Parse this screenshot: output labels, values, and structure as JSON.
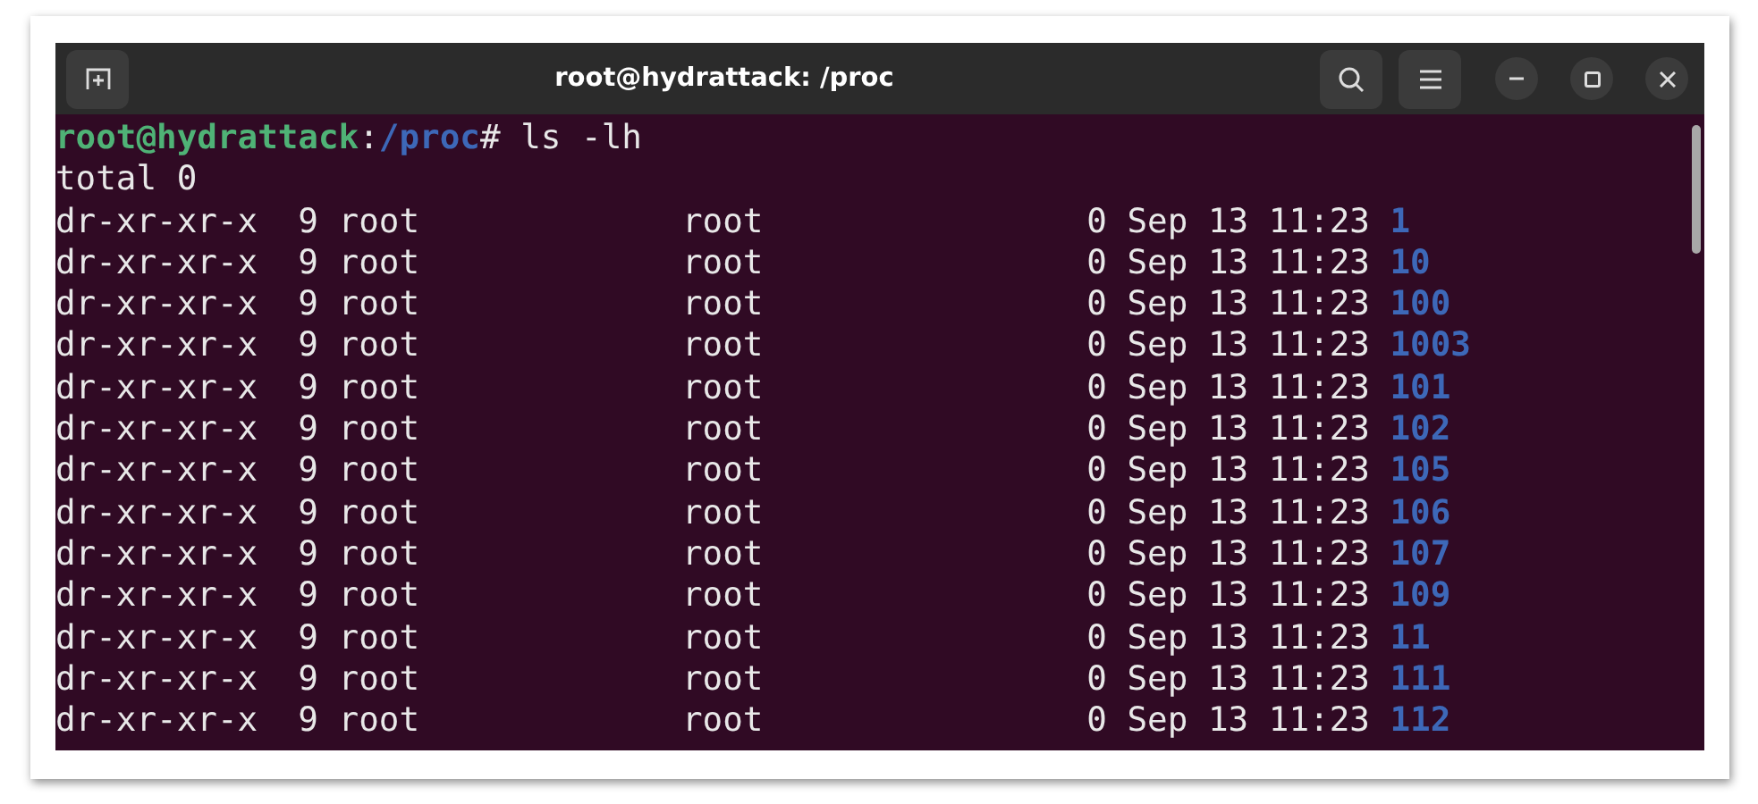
{
  "window": {
    "title": "root@hydrattack: /proc"
  },
  "prompt": {
    "user_host": "root@hydrattack",
    "separator": ":",
    "path": "/proc",
    "symbol": "#",
    "command": " ls -lh"
  },
  "summary": "total 0",
  "rows": [
    {
      "mode": "dr-xr-xr-x",
      "links": "9",
      "owner": "root",
      "group": "root",
      "size": "0",
      "date": "Sep 13 11:23",
      "name": "1"
    },
    {
      "mode": "dr-xr-xr-x",
      "links": "9",
      "owner": "root",
      "group": "root",
      "size": "0",
      "date": "Sep 13 11:23",
      "name": "10"
    },
    {
      "mode": "dr-xr-xr-x",
      "links": "9",
      "owner": "root",
      "group": "root",
      "size": "0",
      "date": "Sep 13 11:23",
      "name": "100"
    },
    {
      "mode": "dr-xr-xr-x",
      "links": "9",
      "owner": "root",
      "group": "root",
      "size": "0",
      "date": "Sep 13 11:23",
      "name": "1003"
    },
    {
      "mode": "dr-xr-xr-x",
      "links": "9",
      "owner": "root",
      "group": "root",
      "size": "0",
      "date": "Sep 13 11:23",
      "name": "101"
    },
    {
      "mode": "dr-xr-xr-x",
      "links": "9",
      "owner": "root",
      "group": "root",
      "size": "0",
      "date": "Sep 13 11:23",
      "name": "102"
    },
    {
      "mode": "dr-xr-xr-x",
      "links": "9",
      "owner": "root",
      "group": "root",
      "size": "0",
      "date": "Sep 13 11:23",
      "name": "105"
    },
    {
      "mode": "dr-xr-xr-x",
      "links": "9",
      "owner": "root",
      "group": "root",
      "size": "0",
      "date": "Sep 13 11:23",
      "name": "106"
    },
    {
      "mode": "dr-xr-xr-x",
      "links": "9",
      "owner": "root",
      "group": "root",
      "size": "0",
      "date": "Sep 13 11:23",
      "name": "107"
    },
    {
      "mode": "dr-xr-xr-x",
      "links": "9",
      "owner": "root",
      "group": "root",
      "size": "0",
      "date": "Sep 13 11:23",
      "name": "109"
    },
    {
      "mode": "dr-xr-xr-x",
      "links": "9",
      "owner": "root",
      "group": "root",
      "size": "0",
      "date": "Sep 13 11:23",
      "name": "11"
    },
    {
      "mode": "dr-xr-xr-x",
      "links": "9",
      "owner": "root",
      "group": "root",
      "size": "0",
      "date": "Sep 13 11:23",
      "name": "111"
    },
    {
      "mode": "dr-xr-xr-x",
      "links": "9",
      "owner": "root",
      "group": "root",
      "size": "0",
      "date": "Sep 13 11:23",
      "name": "112"
    }
  ]
}
